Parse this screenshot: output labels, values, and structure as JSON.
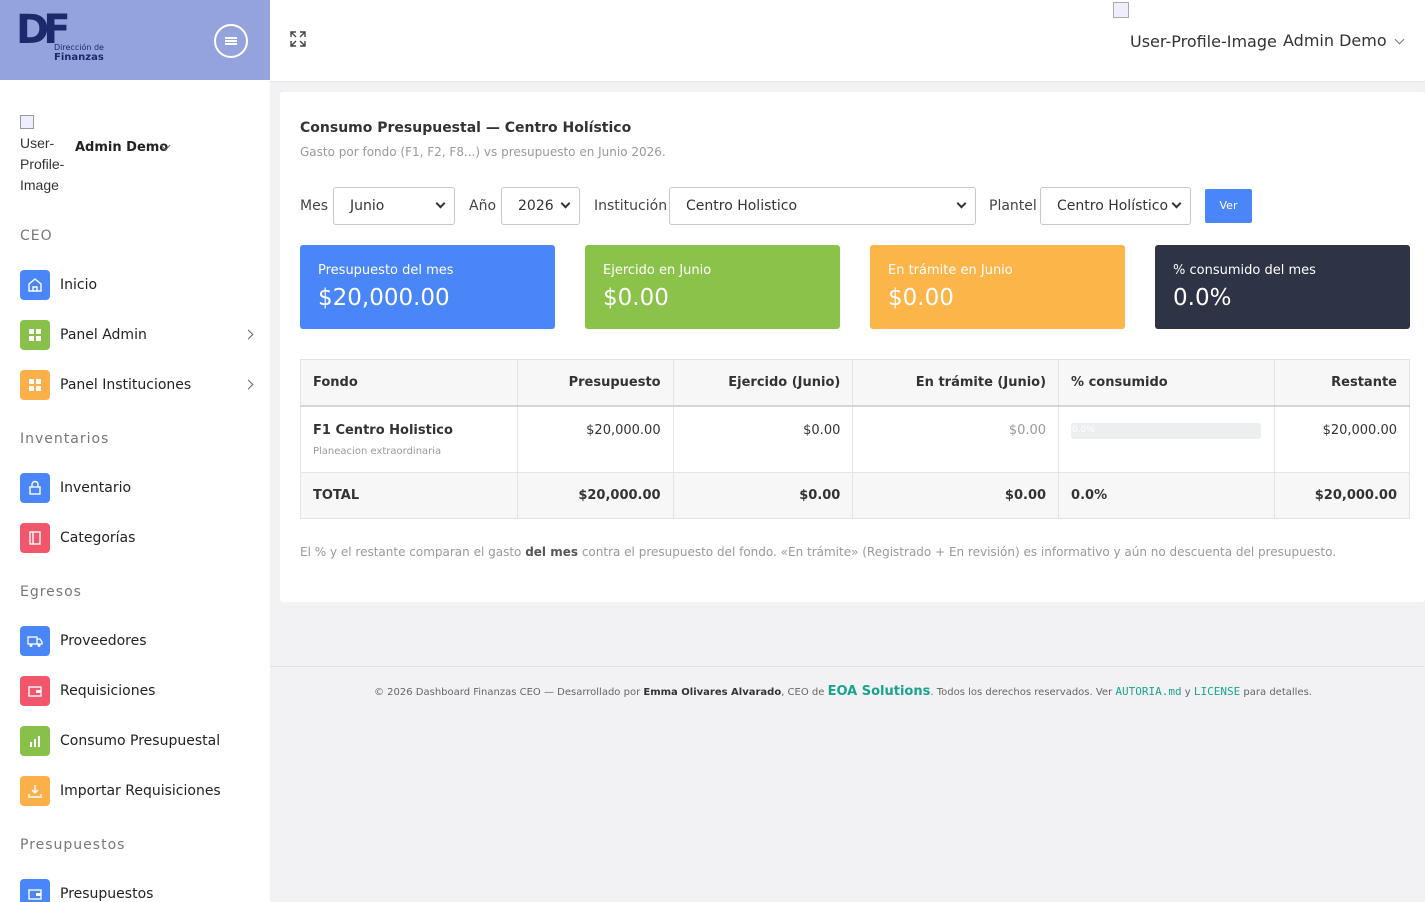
{
  "brand": {
    "logo_letters": "DF",
    "logo_line1": "Dirección de",
    "logo_line2": "Finanzas"
  },
  "sidebar": {
    "user_image_alt": "User-Profile-Image",
    "user_name": "Admin Demo",
    "sections": [
      {
        "title": "CEO",
        "items": [
          {
            "label": "Inicio",
            "icon": "home-icon",
            "color": "#4a86f7"
          },
          {
            "label": "Panel Admin",
            "icon": "grid-icon",
            "color": "#88c04a"
          },
          {
            "label": "Panel Instituciones",
            "icon": "grid-icon",
            "color": "#fbb04a"
          }
        ]
      },
      {
        "title": "Inventarios",
        "items": [
          {
            "label": "Inventario",
            "icon": "lock-icon",
            "color": "#4a86f7"
          },
          {
            "label": "Categorías",
            "icon": "book-icon",
            "color": "#f1566b"
          }
        ]
      },
      {
        "title": "Egresos",
        "items": [
          {
            "label": "Proveedores",
            "icon": "truck-icon",
            "color": "#4a86f7"
          },
          {
            "label": "Requisiciones",
            "icon": "wallet-icon",
            "color": "#f1566b"
          },
          {
            "label": "Consumo Presupuestal",
            "icon": "bar-chart-icon",
            "color": "#88c04a"
          },
          {
            "label": "Importar Requisiciones",
            "icon": "download-icon",
            "color": "#fbb04a"
          }
        ]
      },
      {
        "title": "Presupuestos",
        "items": [
          {
            "label": "Presupuestos",
            "icon": "wallet-icon",
            "color": "#4a86f7"
          }
        ]
      }
    ]
  },
  "topbar": {
    "user_image_alt": "User-Profile-Image",
    "user_name": "Admin Demo"
  },
  "page": {
    "title": "Consumo Presupuestal — Centro Holístico",
    "subtitle": "Gasto por fondo (F1, F2, F8...) vs presupuesto en Junio 2026."
  },
  "filters": {
    "mes_label": "Mes",
    "mes_value": "Junio",
    "anio_label": "Año",
    "anio_value": "2026",
    "institucion_label": "Institución",
    "institucion_value": "Centro Holistico",
    "plantel_label": "Plantel",
    "plantel_value": "Centro Holístico",
    "ver_label": "Ver"
  },
  "stats": [
    {
      "label": "Presupuesto del mes",
      "value": "$20,000.00",
      "color": "#4a86f7"
    },
    {
      "label": "Ejercido en Junio",
      "value": "$0.00",
      "color": "#8bc34a"
    },
    {
      "label": "En trámite en Junio",
      "value": "$0.00",
      "color": "#fbb548"
    },
    {
      "label": "% consumido del mes",
      "value": "0.0%",
      "color": "#2e3345"
    }
  ],
  "table": {
    "headers": [
      "Fondo",
      "Presupuesto",
      "Ejercido (Junio)",
      "En trámite (Junio)",
      "% consumido",
      "Restante"
    ],
    "rows": [
      {
        "fondo": "F1 Centro Holistico",
        "desc": "Planeacion extraordinaria",
        "presupuesto": "$20,000.00",
        "ejercido": "$0.00",
        "tramite": "$0.00",
        "pct_label": "0.0%",
        "pct_value": 0.0,
        "restante": "$20,000.00"
      }
    ],
    "total": {
      "label": "TOTAL",
      "presupuesto": "$20,000.00",
      "ejercido": "$0.00",
      "tramite": "$0.00",
      "pct": "0.0%",
      "restante": "$20,000.00"
    }
  },
  "note": {
    "part1": "El % y el restante comparan el gasto ",
    "bold": "del mes",
    "part2": " contra el presupuesto del fondo. «En trámite» (Registrado + En revisión) es informativo y aún no descuenta del presupuesto."
  },
  "footer": {
    "part1": "© 2026 Dashboard Finanzas CEO — Desarrollado por ",
    "author": "Emma Olivares Alvarado",
    "part2": ", CEO de ",
    "company": "EOA Solutions",
    "part3": ". Todos los derechos reservados. Ver ",
    "file1": "AUTORIA.md",
    "part4": " y ",
    "file2": "LICENSE",
    "part5": " para detalles."
  }
}
